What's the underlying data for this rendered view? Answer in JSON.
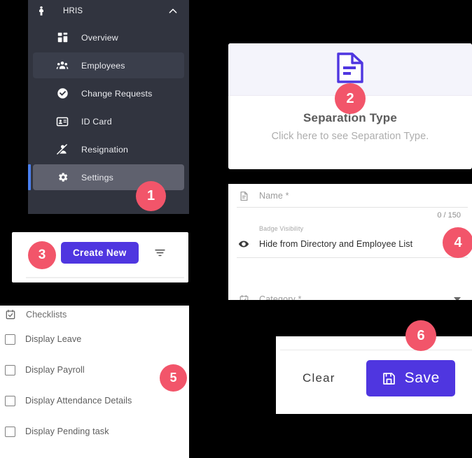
{
  "colors": {
    "badge": "#f2556a",
    "primary": "#4f36e0",
    "sidebar_bg": "#31343f",
    "sidebar_active": "#3a3e4b",
    "sidebar_selected": "#5f616e",
    "sidebar_accent": "#4a80f0",
    "card_header": "#f4f4fb"
  },
  "sidebar": {
    "title": "HRIS",
    "user_icon": "person-icon",
    "collapse_icon": "chevron-up-icon",
    "items": [
      {
        "label": "Overview",
        "icon": "dashboard-grid-icon",
        "state": "default"
      },
      {
        "label": "Employees",
        "icon": "people-group-icon",
        "state": "active"
      },
      {
        "label": "Change Requests",
        "icon": "check-circle-icon",
        "state": "default"
      },
      {
        "label": "ID Card",
        "icon": "id-card-icon",
        "state": "default"
      },
      {
        "label": "Resignation",
        "icon": "person-off-icon",
        "state": "default"
      },
      {
        "label": "Settings",
        "icon": "gear-icon",
        "state": "selected"
      }
    ]
  },
  "separation_card": {
    "icon": "document-lines-icon",
    "title": "Separation Type",
    "subtitle": "Click here to see Separation Type."
  },
  "create_toolbar": {
    "create_label": "Create New",
    "filter_icon": "filter-icon"
  },
  "form": {
    "name_field": {
      "icon": "document-icon",
      "placeholder": "Name *",
      "value": "",
      "counter": "0 / 150"
    },
    "badge_visibility": {
      "icon": "eye-icon",
      "label": "Badge Visibility",
      "value": "Hide from Directory and Employee List"
    },
    "category_field": {
      "icon": "calendar-check-icon",
      "placeholder": "Category *",
      "value": "",
      "caret_icon": "caret-down-icon"
    }
  },
  "checklists": {
    "header": {
      "label": "Checklists",
      "icon": "calendar-check-icon"
    },
    "items": [
      {
        "label": "Display Leave",
        "checked": false
      },
      {
        "label": "Display Payroll",
        "checked": false
      },
      {
        "label": "Display Attendance Details",
        "checked": false
      },
      {
        "label": "Display Pending task",
        "checked": false
      }
    ]
  },
  "save_bar": {
    "clear_label": "Clear",
    "save_label": "Save",
    "save_icon": "floppy-disk-icon"
  },
  "badges": [
    {
      "number": "1"
    },
    {
      "number": "2"
    },
    {
      "number": "3"
    },
    {
      "number": "4"
    },
    {
      "number": "5"
    },
    {
      "number": "6"
    }
  ]
}
